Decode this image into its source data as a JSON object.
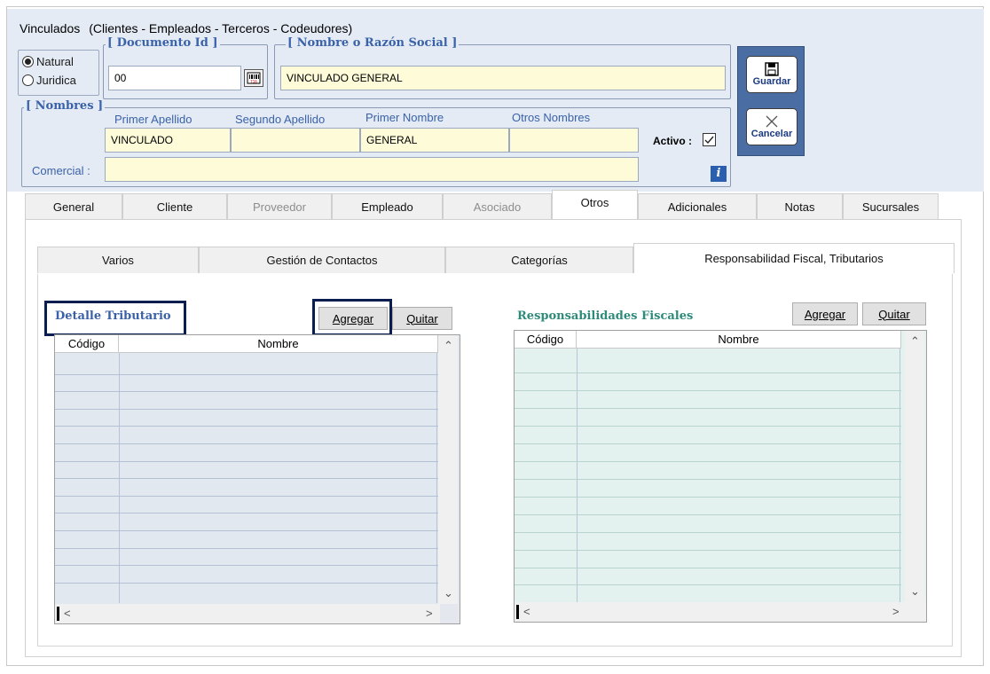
{
  "window": {
    "title": "Vinculados",
    "subtitle": "(Clientes - Empleados - Terceros - Codeudores)"
  },
  "person_type": {
    "options": [
      {
        "label": "Natural",
        "selected": true
      },
      {
        "label": "Juridica",
        "selected": false
      }
    ]
  },
  "documento": {
    "legend": "[ Documento Id ]",
    "value": "00"
  },
  "razon_social": {
    "legend": "[ Nombre o Razón Social ]",
    "value": "VINCULADO GENERAL"
  },
  "nombres": {
    "legend": "[ Nombres ]",
    "primer_apellido_label": "Primer Apellido",
    "primer_apellido_value": "VINCULADO",
    "segundo_apellido_label": "Segundo Apellido",
    "segundo_apellido_value": "",
    "primer_nombre_label": "Primer Nombre",
    "primer_nombre_value": "GENERAL",
    "otros_nombres_label": "Otros Nombres",
    "otros_nombres_value": "",
    "comercial_label": "Comercial :",
    "comercial_value": "",
    "activo_label": "Activo :",
    "activo_checked": true
  },
  "actions": {
    "guardar": "Guardar",
    "cancelar": "Cancelar"
  },
  "main_tabs": [
    {
      "label": "General",
      "state": "normal"
    },
    {
      "label": "Cliente",
      "state": "normal"
    },
    {
      "label": "Proveedor",
      "state": "disabled"
    },
    {
      "label": "Empleado",
      "state": "normal"
    },
    {
      "label": "Asociado",
      "state": "disabled"
    },
    {
      "label": "Otros",
      "state": "active"
    },
    {
      "label": "Adicionales",
      "state": "normal"
    },
    {
      "label": "Notas",
      "state": "normal"
    },
    {
      "label": "Sucursales",
      "state": "normal"
    }
  ],
  "sub_tabs": [
    {
      "label": "Varios",
      "active": false
    },
    {
      "label": "Gestión de Contactos",
      "active": false
    },
    {
      "label": "Categorías",
      "active": false
    },
    {
      "label": "Responsabilidad Fiscal, Tributarios",
      "active": true
    }
  ],
  "detalle_tributario": {
    "title": "Detalle Tributario",
    "add_label": "Agregar",
    "remove_label": "Quitar",
    "columns": [
      "Código",
      "Nombre"
    ]
  },
  "responsabilidades": {
    "title": "Responsabilidades Fiscales",
    "add_label": "Agregar",
    "remove_label": "Quitar",
    "columns": [
      "Código",
      "Nombre"
    ]
  },
  "colors": {
    "header_bg": "#e4ebf5",
    "accent_blue": "#3a62a8",
    "teal_title": "#2e8b7a",
    "grid_left_bg": "#e2e8f0",
    "grid_right_bg": "#e4f2ef",
    "side_panel": "#4a6ea4",
    "highlight": "#0a1d4f"
  }
}
